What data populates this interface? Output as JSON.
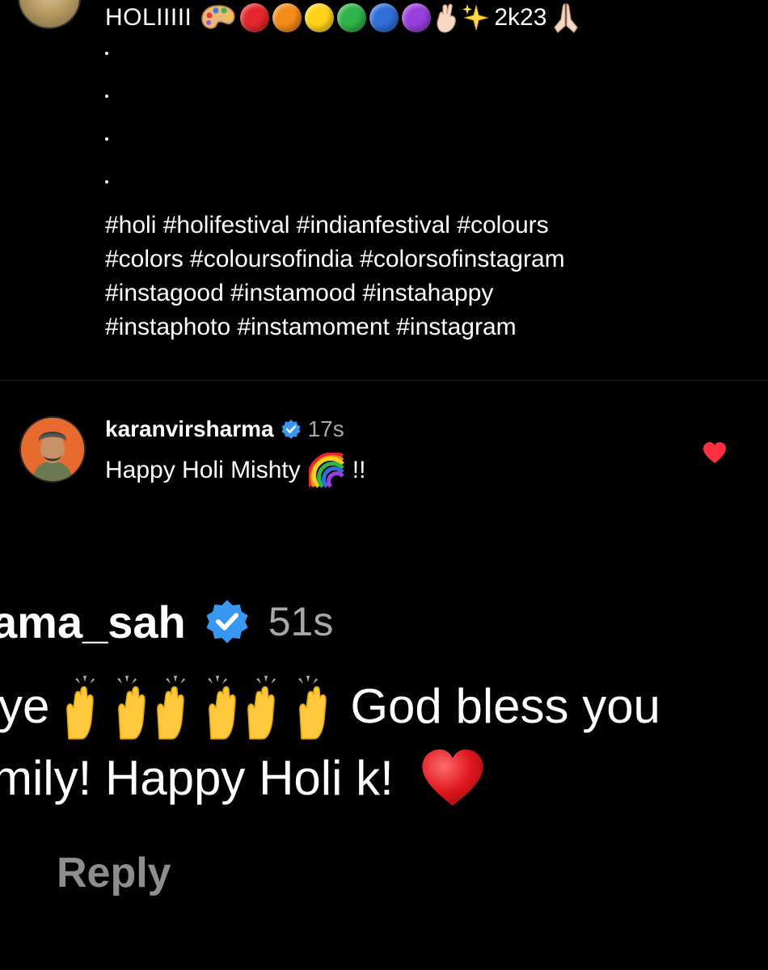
{
  "caption": {
    "title": "HOLIIIII",
    "year": "2k23",
    "color_dots": [
      "#e5262d",
      "#f38b18",
      "#ffd21a",
      "#2fb34a",
      "#2f6fd6",
      "#9a3fdc"
    ],
    "icons": [
      "artist-palette-icon",
      "hand-icon",
      "sparkles-icon",
      "folded-hands-icon"
    ],
    "hashtag_lines": [
      "#holi #holifestival #indianfestival #colours",
      "#colors #coloursofindia #colorsofinstagram",
      "#instagood #instamood #instahappy",
      "#instaphoto #instamoment #instagram"
    ]
  },
  "comment": {
    "username": "karanvirsharma",
    "time": "17s",
    "text": "Happy Holi Mishty",
    "suffix": "!!",
    "liked": true,
    "heart_color": "#ff3040"
  },
  "zoomed_comment": {
    "username_partial": "ama_sah",
    "time": "51s",
    "line1_start": "ye",
    "line1_end": "God bless you",
    "line2": "mily! Happy Holi k!",
    "reply_label": "Reply"
  },
  "colors": {
    "background": "#000000",
    "text": "#ffffff",
    "muted": "#a8a8a8",
    "verified": "#3897f0"
  }
}
